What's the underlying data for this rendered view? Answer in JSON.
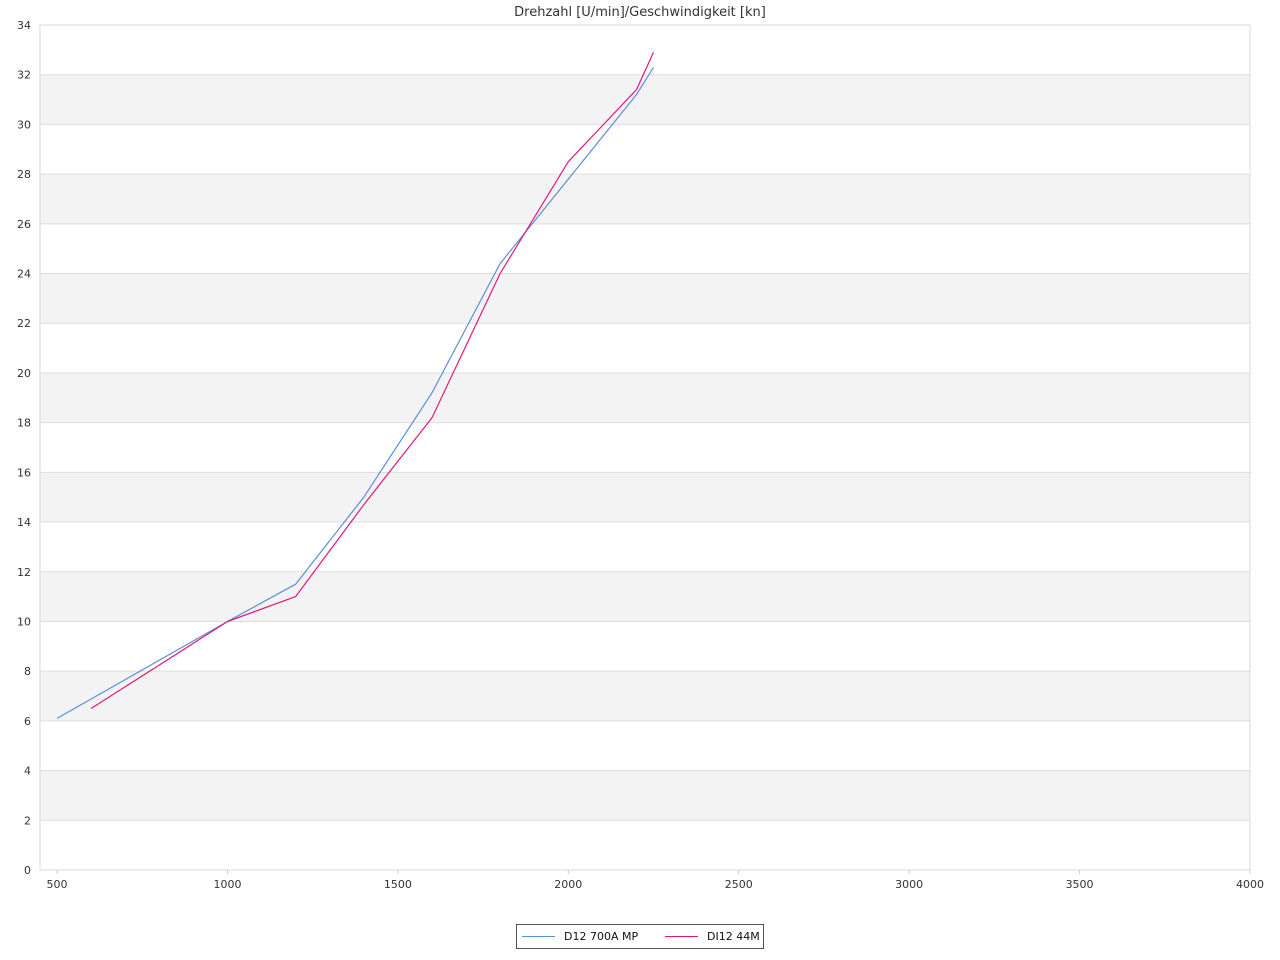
{
  "chart_data": {
    "type": "line",
    "title": "Drehzahl [U/min]/Geschwindigkeit [kn]",
    "xlabel": "",
    "ylabel": "",
    "xlim": [
      450,
      4000
    ],
    "ylim": [
      0,
      34
    ],
    "x_ticks": [
      500,
      1000,
      1500,
      2000,
      2500,
      3000,
      3500,
      4000
    ],
    "y_ticks": [
      0,
      2,
      4,
      6,
      8,
      10,
      12,
      14,
      16,
      18,
      20,
      22,
      24,
      26,
      28,
      30,
      32,
      34
    ],
    "grid": "horizontal alternating bands",
    "legend_position": "bottom-center",
    "series": [
      {
        "name": "D12 700A MP",
        "color": "#5b8fd6",
        "x": [
          500,
          1000,
          1200,
          1400,
          1600,
          1800,
          2000,
          2200,
          2250
        ],
        "y": [
          6.1,
          10.0,
          11.5,
          15.0,
          19.2,
          24.4,
          27.8,
          31.2,
          32.3
        ]
      },
      {
        "name": "DI12 44M",
        "color": "#e0197d",
        "x": [
          600,
          1000,
          1200,
          1400,
          1600,
          1800,
          2000,
          2200,
          2250
        ],
        "y": [
          6.5,
          10.0,
          11.0,
          14.7,
          18.2,
          24.0,
          28.5,
          31.4,
          32.9
        ]
      }
    ]
  }
}
